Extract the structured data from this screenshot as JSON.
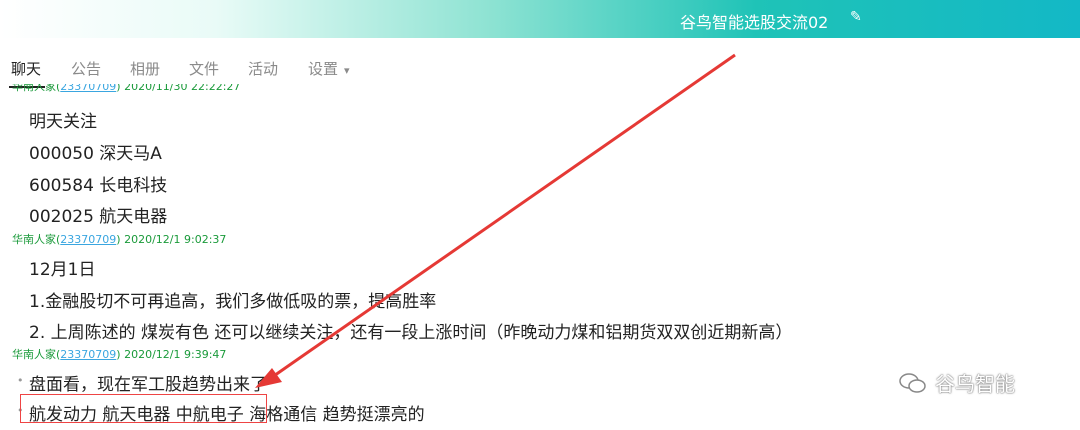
{
  "header": {
    "title": "谷鸟智能选股交流02",
    "edit_icon": "pencil-icon"
  },
  "tabs": [
    {
      "label": "聊天",
      "active": true
    },
    {
      "label": "公告"
    },
    {
      "label": "相册"
    },
    {
      "label": "文件"
    },
    {
      "label": "活动"
    },
    {
      "label": "设置"
    }
  ],
  "messages": [
    {
      "sender": "华南人家",
      "uid": "23370709",
      "time": "2020/11/30 22:22:27",
      "lines": [
        "明天关注",
        "000050 深天马A",
        "600584 长电科技",
        "002025 航天电器"
      ]
    },
    {
      "sender": "华南人家",
      "uid": "23370709",
      "time": "2020/12/1 9:02:37",
      "lines": [
        "12月1日",
        "1.金融股切不可再追高，我们多做低吸的票，提高胜率",
        "2. 上周陈述的 煤炭有色 还可以继续关注，还有一段上涨时间（昨晚动力煤和铝期货双双创近期新高）"
      ]
    },
    {
      "sender": "华南人家",
      "uid": "23370709",
      "time": "2020/12/1 9:39:47",
      "lines": [
        "盘面看，现在军工股趋势出来了",
        "航发动力  航天电器  中航电子  海格通信 趋势挺漂亮的"
      ]
    }
  ],
  "watermark": "谷鸟智能",
  "colors": {
    "accent": "#13b8c6",
    "annotation": "#e53935",
    "sender": "#1a9a3a"
  }
}
